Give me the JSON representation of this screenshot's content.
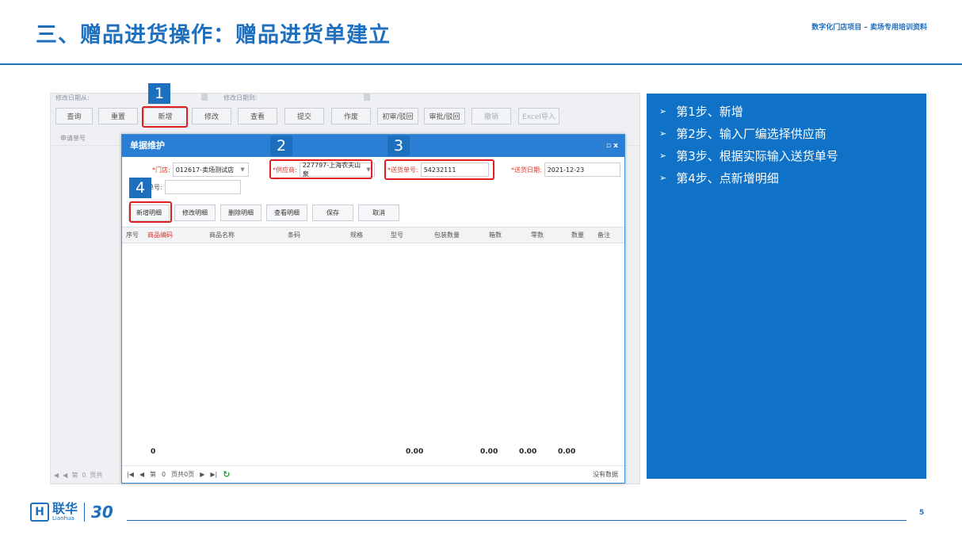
{
  "slide": {
    "title": "三、赠品进货操作：赠品进货单建立",
    "subtitle": "数字化门店项目 – 卖场专用培训资料",
    "page_number": "5"
  },
  "app": {
    "filter_labels": [
      "修改日期从:",
      "修改日期到:"
    ],
    "toolbar": [
      "查询",
      "重置",
      "新增",
      "修改",
      "查看",
      "提交",
      "作废",
      "初审/驳回",
      "审批/驳回",
      "撤销",
      "Excel导入"
    ],
    "grid_header_label": "申请单号",
    "pager": {
      "first": "◀",
      "prev": "◀",
      "page_label": "第",
      "page_value": "0",
      "total": "页共"
    }
  },
  "dialog": {
    "title": "单据维护",
    "controls": "▫ x",
    "store": {
      "label": "*门店:",
      "value": "012617-卖场测试店"
    },
    "supplier": {
      "label": "*供应商:",
      "value": "227797-上海农夫山泉"
    },
    "delivery_no": {
      "label": "*送货单号:",
      "value": "54232111"
    },
    "delivery_date": {
      "label": "*送货日期:",
      "value": "2021-12-23"
    },
    "factory_no": {
      "label": "单号:",
      "value": ""
    },
    "buttons": [
      "新增明细",
      "修改明细",
      "删除明细",
      "查看明细",
      "保存",
      "取消"
    ],
    "columns": [
      "序号",
      "商品编码",
      "商品名称",
      "条码",
      "规格",
      "型号",
      "包装数量",
      "箱数",
      "零数",
      "数量",
      "备注"
    ],
    "totals": {
      "count": "0",
      "package_qty": "0.00",
      "boxes": "0.00",
      "loose": "0.00",
      "qty": "0.00"
    },
    "pager": {
      "page_label": "第",
      "page_value": "0",
      "total_pages": "页共0页",
      "refresh_icon": "↻",
      "no_data": "没有数据"
    }
  },
  "markers": [
    "1",
    "2",
    "3",
    "4"
  ],
  "steps": [
    "第1步、新增",
    "第2步、输入厂编选择供应商",
    "第3步、根据实际输入送货单号",
    "第4步、点新增明细"
  ],
  "footer": {
    "logo_mark": "H",
    "brand_cn": "联华",
    "brand_en": "Lianhua",
    "anniversary": "30"
  },
  "colors": {
    "brand_blue": "#1f6fbf",
    "panel_blue": "#0f72c7",
    "highlight_red": "#e02020",
    "dialog_header": "#2a7fd4"
  }
}
